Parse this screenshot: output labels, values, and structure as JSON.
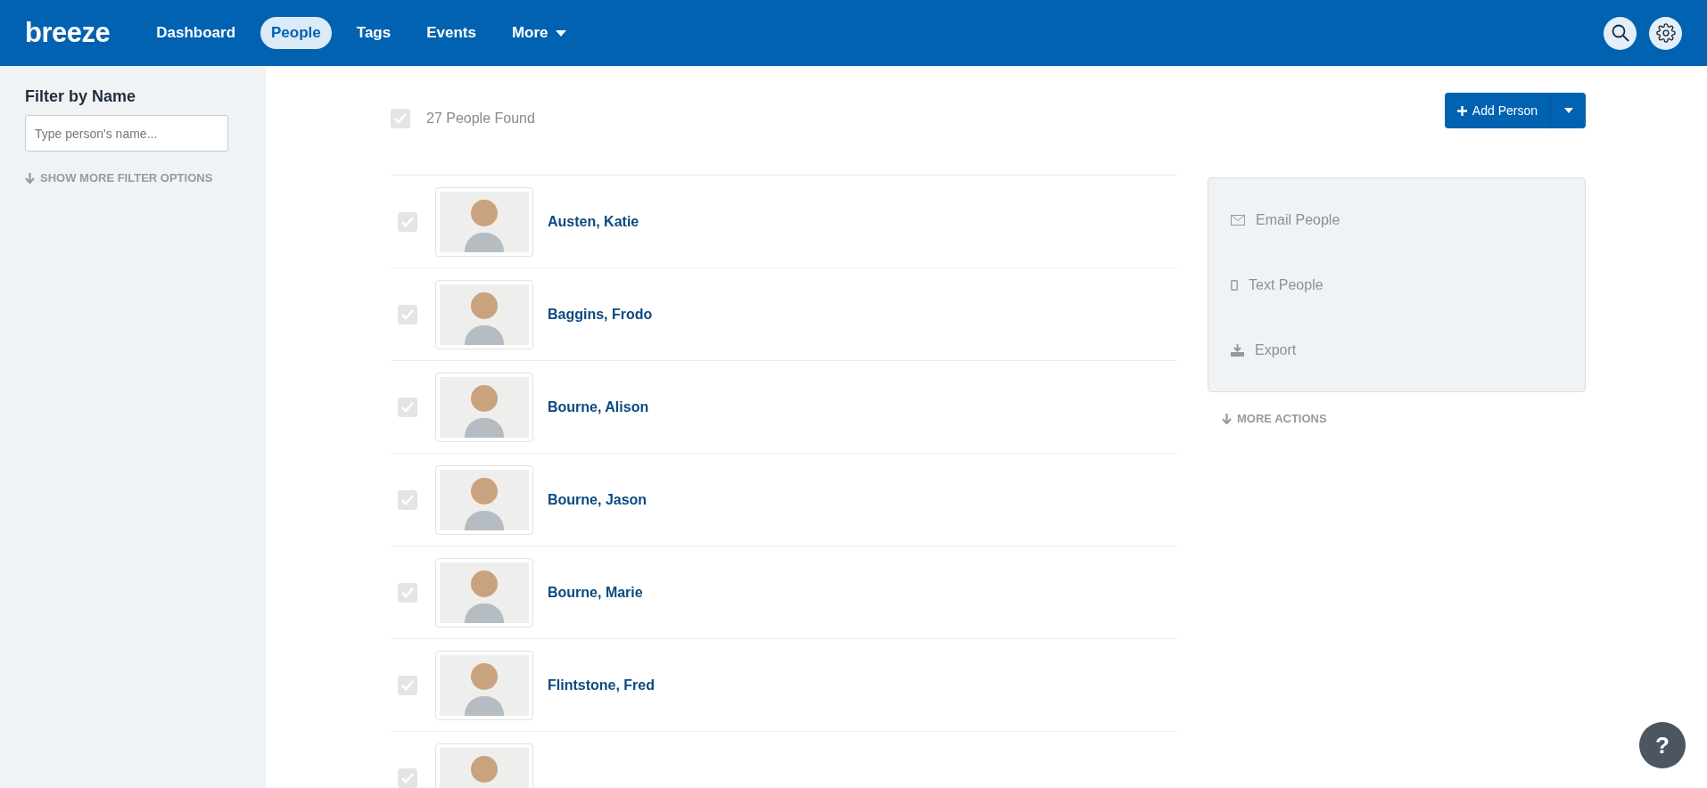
{
  "nav": {
    "logo": "breeze",
    "items": [
      {
        "label": "Dashboard",
        "selected": false
      },
      {
        "label": "People",
        "selected": true
      },
      {
        "label": "Tags",
        "selected": false
      },
      {
        "label": "Events",
        "selected": false
      },
      {
        "label": "More",
        "selected": false,
        "kind": "dropdown"
      }
    ]
  },
  "sidebar": {
    "title": "Filter by Name",
    "search": {
      "placeholder": "Type person's name..."
    },
    "more_link": "SHOW MORE FILTER OPTIONS"
  },
  "list_header": {
    "checked": true,
    "count": "27 People Found"
  },
  "add_button": "Add Person",
  "people": [
    {
      "name": "Austen, Katie",
      "checked": true
    },
    {
      "name": "Baggins, Frodo",
      "checked": true
    },
    {
      "name": "Bourne, Alison",
      "checked": true
    },
    {
      "name": "Bourne, Jason",
      "checked": true
    },
    {
      "name": "Bourne, Marie",
      "checked": true
    },
    {
      "name": "Flintstone, Fred",
      "checked": true
    },
    {
      "checked": true
    }
  ],
  "actions": [
    {
      "label": "Email People",
      "kind": "email"
    },
    {
      "label": "Text People",
      "kind": "phone"
    },
    {
      "label": "Export",
      "kind": "export"
    }
  ],
  "more_actions": "MORE ACTIONS",
  "help": "?"
}
